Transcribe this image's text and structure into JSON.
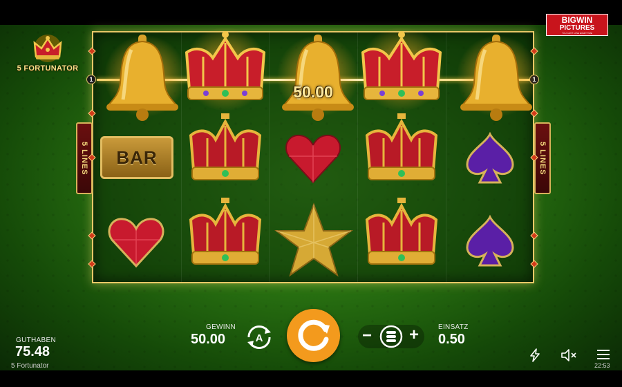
{
  "game": {
    "logo_text": "5 FORTUNATOR",
    "name": "5 Fortunator"
  },
  "brand": {
    "line1": "BIGWIN",
    "line2": "PICTURES",
    "tagline": "YOU CAN'T LOSE EVERY TIME"
  },
  "reels": {
    "lines_badge_left": "5 LINES",
    "lines_badge_right": "5 LINES",
    "payline_numbers": [
      "1",
      "1"
    ],
    "win_amount": "50.00",
    "grid": [
      [
        "bell",
        "crown",
        "bell",
        "crown",
        "bell"
      ],
      [
        "bar",
        "crown",
        "heart",
        "crown",
        "spade"
      ],
      [
        "heart",
        "crown",
        "star",
        "crown",
        "spade"
      ]
    ],
    "bar_label": "BAR"
  },
  "panel": {
    "balance_label": "GUTHABEN",
    "balance_value": "75.48",
    "win_label": "GEWINN",
    "win_value": "50.00",
    "bet_label": "EINSATZ",
    "bet_value": "0.50",
    "autoplay_icon": "autoplay-a-icon",
    "spin_icon": "spin-icon",
    "bet_minus_label": "−",
    "bet_plus_label": "+",
    "bet_icon": "coin-stack-icon"
  },
  "toolbar": {
    "turbo_icon": "lightning-icon",
    "sound_icon": "speaker-muted-icon",
    "menu_icon": "hamburger-menu-icon"
  },
  "clock": "22:53",
  "colors": {
    "felt": "#2a7412",
    "frame_gold": "#e8c867",
    "spin_orange": "#f39a1d",
    "brand_red": "#c8141c"
  }
}
